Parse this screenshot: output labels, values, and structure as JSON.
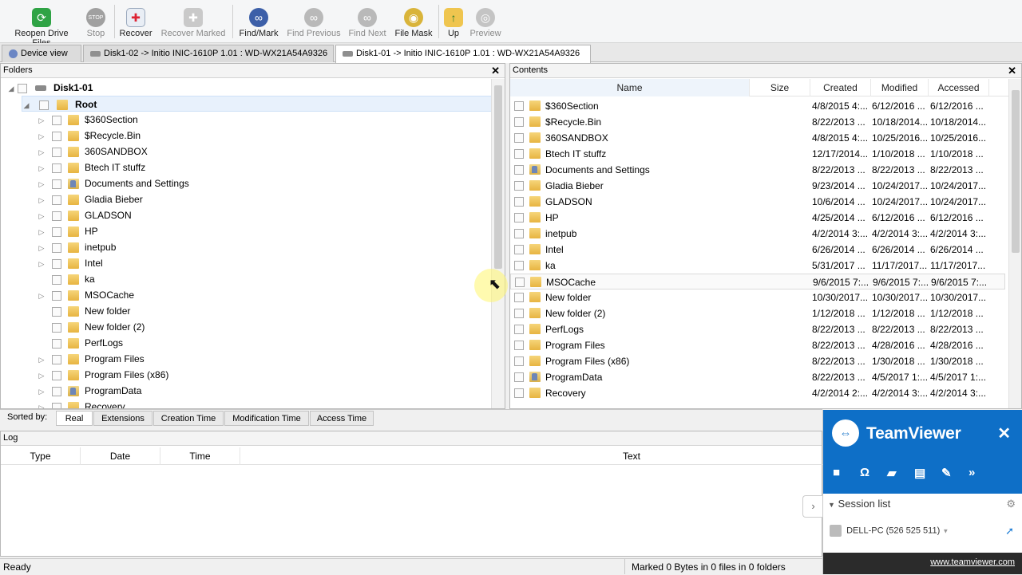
{
  "toolbar": {
    "buttons": [
      {
        "label": "Reopen Drive Files",
        "icon": "reopen-icon",
        "enabled": true
      },
      {
        "label": "Stop",
        "icon": "stop-icon",
        "enabled": false
      },
      {
        "label": "Recover",
        "icon": "recover-icon",
        "enabled": true
      },
      {
        "label": "Recover Marked",
        "icon": "recover-marked-icon",
        "enabled": false
      },
      {
        "label": "Find/Mark",
        "icon": "binoculars-icon",
        "enabled": true
      },
      {
        "label": "Find Previous",
        "icon": "binoculars-prev-icon",
        "enabled": false
      },
      {
        "label": "Find Next",
        "icon": "binoculars-next-icon",
        "enabled": false
      },
      {
        "label": "File Mask",
        "icon": "file-mask-icon",
        "enabled": true
      },
      {
        "label": "Up",
        "icon": "folder-up-icon",
        "enabled": true
      },
      {
        "label": "Preview",
        "icon": "preview-icon",
        "enabled": false
      }
    ],
    "stop_icon_text": "STOP"
  },
  "tabs": [
    {
      "label": "Device view",
      "active": false
    },
    {
      "label": "Disk1-02 -> Initio INIC-1610P 1.01 : WD-WX21A54A9326",
      "active": false
    },
    {
      "label": "Disk1-01 -> Initio INIC-1610P 1.01 : WD-WX21A54A9326",
      "active": true
    }
  ],
  "folders": {
    "title": "Folders",
    "disk": "Disk1-01",
    "root": "Root",
    "items": [
      {
        "name": "$360Section",
        "expandable": true,
        "special": false
      },
      {
        "name": "$Recycle.Bin",
        "expandable": true,
        "special": false
      },
      {
        "name": "360SANDBOX",
        "expandable": true,
        "special": false
      },
      {
        "name": "Btech IT stuffz",
        "expandable": true,
        "special": false
      },
      {
        "name": "Documents and Settings",
        "expandable": true,
        "special": true
      },
      {
        "name": "Gladia Bieber",
        "expandable": true,
        "special": false
      },
      {
        "name": "GLADSON",
        "expandable": true,
        "special": false
      },
      {
        "name": "HP",
        "expandable": true,
        "special": false
      },
      {
        "name": "inetpub",
        "expandable": true,
        "special": false
      },
      {
        "name": "Intel",
        "expandable": true,
        "special": false
      },
      {
        "name": "ka",
        "expandable": false,
        "special": false
      },
      {
        "name": "MSOCache",
        "expandable": true,
        "special": false
      },
      {
        "name": "New folder",
        "expandable": false,
        "special": false
      },
      {
        "name": "New folder (2)",
        "expandable": false,
        "special": false
      },
      {
        "name": "PerfLogs",
        "expandable": false,
        "special": false
      },
      {
        "name": "Program Files",
        "expandable": true,
        "special": false
      },
      {
        "name": "Program Files (x86)",
        "expandable": true,
        "special": false
      },
      {
        "name": "ProgramData",
        "expandable": true,
        "special": true
      },
      {
        "name": "Recovery",
        "expandable": true,
        "special": false
      }
    ]
  },
  "contents": {
    "title": "Contents",
    "columns": [
      "Name",
      "Size",
      "Created",
      "Modified",
      "Accessed"
    ],
    "rows": [
      {
        "name": "$360Section",
        "created": "4/8/2015 4:...",
        "modified": "6/12/2016 ...",
        "accessed": "6/12/2016 ...",
        "special": false
      },
      {
        "name": "$Recycle.Bin",
        "created": "8/22/2013 ...",
        "modified": "10/18/2014...",
        "accessed": "10/18/2014...",
        "special": false
      },
      {
        "name": "360SANDBOX",
        "created": "4/8/2015 4:...",
        "modified": "10/25/2016...",
        "accessed": "10/25/2016...",
        "special": false
      },
      {
        "name": "Btech IT stuffz",
        "created": "12/17/2014...",
        "modified": "1/10/2018 ...",
        "accessed": "1/10/2018 ...",
        "special": false
      },
      {
        "name": "Documents and Settings",
        "created": "8/22/2013 ...",
        "modified": "8/22/2013 ...",
        "accessed": "8/22/2013 ...",
        "special": true
      },
      {
        "name": "Gladia Bieber",
        "created": "9/23/2014 ...",
        "modified": "10/24/2017...",
        "accessed": "10/24/2017...",
        "special": false
      },
      {
        "name": "GLADSON",
        "created": "10/6/2014 ...",
        "modified": "10/24/2017...",
        "accessed": "10/24/2017...",
        "special": false
      },
      {
        "name": "HP",
        "created": "4/25/2014 ...",
        "modified": "6/12/2016 ...",
        "accessed": "6/12/2016 ...",
        "special": false
      },
      {
        "name": "inetpub",
        "created": "4/2/2014 3:...",
        "modified": "4/2/2014 3:...",
        "accessed": "4/2/2014 3:...",
        "special": false
      },
      {
        "name": "Intel",
        "created": "6/26/2014 ...",
        "modified": "6/26/2014 ...",
        "accessed": "6/26/2014 ...",
        "special": false
      },
      {
        "name": "ka",
        "created": "5/31/2017 ...",
        "modified": "11/17/2017...",
        "accessed": "11/17/2017...",
        "special": false
      },
      {
        "name": "MSOCache",
        "created": "9/6/2015 7:...",
        "modified": "9/6/2015 7:...",
        "accessed": "9/6/2015 7:...",
        "special": false
      },
      {
        "name": "New folder",
        "created": "10/30/2017...",
        "modified": "10/30/2017...",
        "accessed": "10/30/2017...",
        "special": false
      },
      {
        "name": "New folder (2)",
        "created": "1/12/2018 ...",
        "modified": "1/12/2018 ...",
        "accessed": "1/12/2018 ...",
        "special": false
      },
      {
        "name": "PerfLogs",
        "created": "8/22/2013 ...",
        "modified": "8/22/2013 ...",
        "accessed": "8/22/2013 ...",
        "special": false
      },
      {
        "name": "Program Files",
        "created": "8/22/2013 ...",
        "modified": "4/28/2016 ...",
        "accessed": "4/28/2016 ...",
        "special": false
      },
      {
        "name": "Program Files (x86)",
        "created": "8/22/2013 ...",
        "modified": "1/30/2018 ...",
        "accessed": "1/30/2018 ...",
        "special": false
      },
      {
        "name": "ProgramData",
        "created": "8/22/2013 ...",
        "modified": "4/5/2017 1:...",
        "accessed": "4/5/2017 1:...",
        "special": true
      },
      {
        "name": "Recovery",
        "created": "4/2/2014 2:...",
        "modified": "4/2/2014 3:...",
        "accessed": "4/2/2014 3:...",
        "special": false
      }
    ]
  },
  "sortbar": {
    "label": "Sorted by:",
    "buttons": [
      "Real",
      "Extensions",
      "Creation Time",
      "Modification Time",
      "Access Time"
    ],
    "active": "Real"
  },
  "log": {
    "title": "Log",
    "columns": [
      "Type",
      "Date",
      "Time",
      "Text"
    ]
  },
  "status": {
    "left": "Ready",
    "right": "Marked 0 Bytes in 0 files in 0 folders"
  },
  "teamviewer": {
    "name": "TeamViewer",
    "session_list": "Session list",
    "session_item": "DELL-PC (526 525 511)",
    "url": "www.teamviewer.com",
    "close_symbol": "✕",
    "toolbar_icons": [
      "video-icon",
      "headset-icon",
      "chat-icon",
      "files-icon",
      "tools-icon",
      "more-icon"
    ]
  },
  "colors": {
    "teamviewer_blue": "#0e6fc7",
    "folder_yellow": "#e7b441",
    "cursor_highlight": "#fff56e"
  }
}
